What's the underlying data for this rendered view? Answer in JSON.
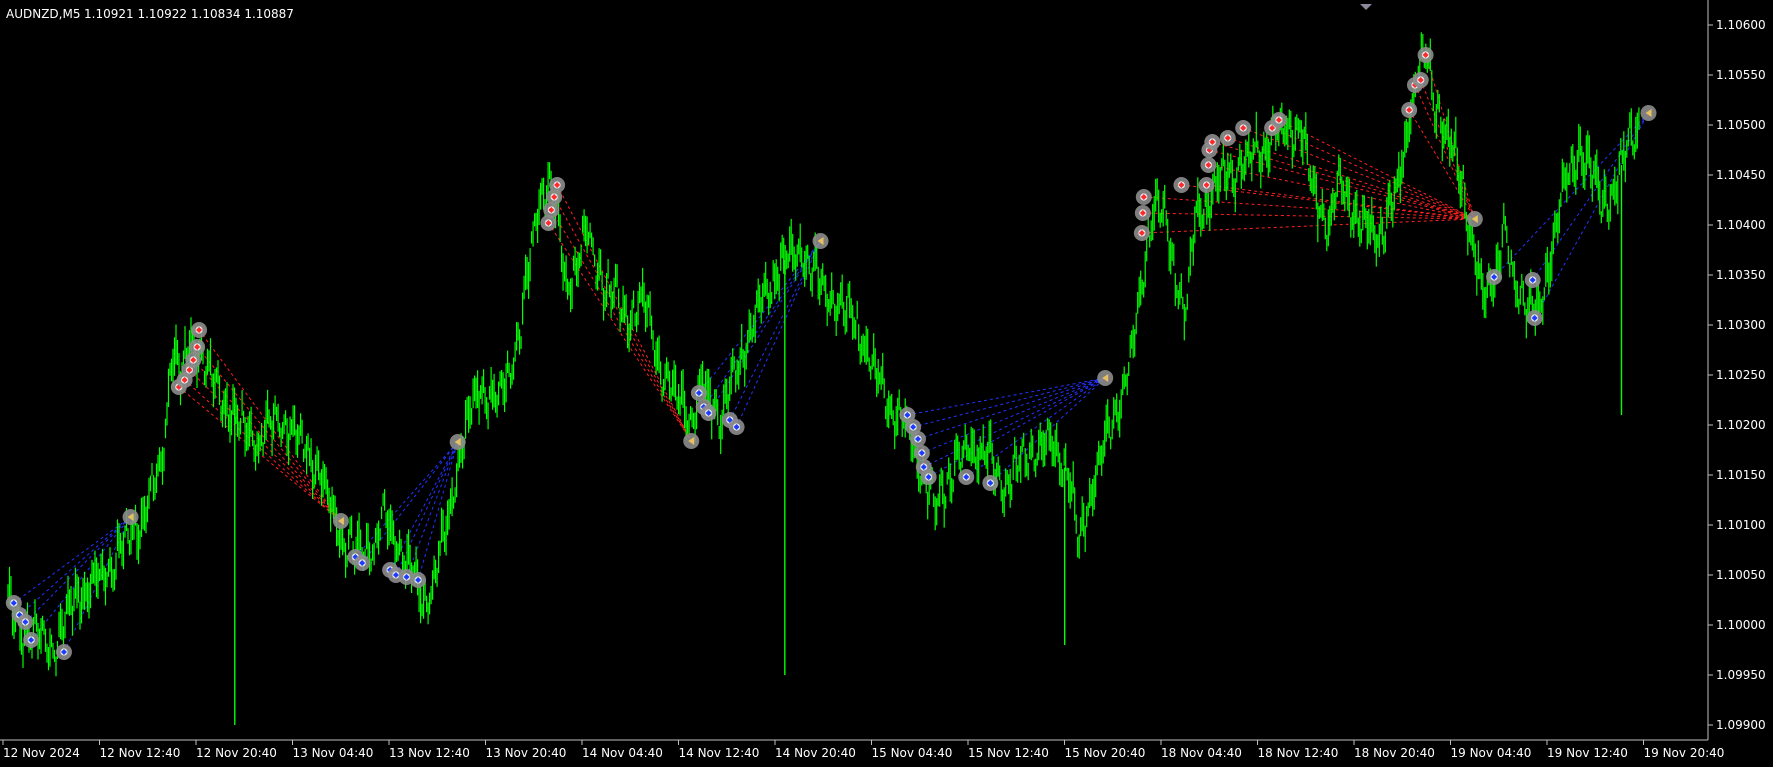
{
  "header": {
    "symbol_label": "AUDNZD,M5",
    "ohlc_text": "1.10921 1.10922 1.10834 1.10887"
  },
  "colors": {
    "background": "#000000",
    "price_line": "#00FF00",
    "axis_text": "#FFFFFF",
    "axis_frame": "#C0C0C0",
    "buy_link": "#2233FF",
    "sell_link": "#FF2020",
    "buy_marker": "#1E3CFF",
    "sell_marker": "#FF2A2A",
    "marker_halo": "#8C8C8C",
    "close_marker": "#E8C060"
  },
  "chart_data": {
    "type": "line",
    "title": "",
    "xlabel": "",
    "ylabel": "",
    "ylim": [
      1.0988,
      1.10628
    ],
    "x_tick_labels": [
      "12 Nov 2024",
      "12 Nov 12:40",
      "12 Nov 20:40",
      "13 Nov 04:40",
      "13 Nov 12:40",
      "13 Nov 20:40",
      "14 Nov 04:40",
      "14 Nov 12:40",
      "14 Nov 20:40",
      "15 Nov 04:40",
      "15 Nov 12:40",
      "15 Nov 20:40",
      "18 Nov 04:40",
      "18 Nov 12:40",
      "18 Nov 20:40",
      "19 Nov 04:40",
      "19 Nov 12:40",
      "19 Nov 20:40"
    ],
    "y_ticks": [
      "1.10600",
      "1.10550",
      "1.10500",
      "1.10450",
      "1.10400",
      "1.10350",
      "1.10300",
      "1.10250",
      "1.10200",
      "1.10150",
      "1.10100",
      "1.10050",
      "1.10000",
      "1.09950",
      "1.09900"
    ],
    "price_anchors": [
      [
        0,
        1.1002
      ],
      [
        1,
        1.1
      ],
      [
        3,
        1.09985
      ],
      [
        5,
        1.0998
      ],
      [
        7,
        1.1003
      ],
      [
        10,
        1.1005
      ],
      [
        12,
        1.1008
      ],
      [
        14,
        1.1011
      ],
      [
        16,
        1.1016
      ],
      [
        17,
        1.1028
      ],
      [
        18,
        1.1024
      ],
      [
        19,
        1.1029
      ],
      [
        20,
        1.1027
      ],
      [
        22,
        1.1023
      ],
      [
        24,
        1.102
      ],
      [
        26,
        1.1018
      ],
      [
        28,
        1.1021
      ],
      [
        30,
        1.1019
      ],
      [
        32,
        1.1016
      ],
      [
        34,
        1.101
      ],
      [
        36,
        1.1007
      ],
      [
        38,
        1.1008
      ],
      [
        39,
        1.1011
      ],
      [
        40,
        1.1009
      ],
      [
        42,
        1.1005
      ],
      [
        43,
        1.1002
      ],
      [
        44,
        1.1004
      ],
      [
        46,
        1.1012
      ],
      [
        47,
        1.1018
      ],
      [
        49,
        1.1024
      ],
      [
        51,
        1.1022
      ],
      [
        53,
        1.1029
      ],
      [
        54,
        1.1035
      ],
      [
        55,
        1.1043
      ],
      [
        56,
        1.1045
      ],
      [
        57,
        1.104
      ],
      [
        58,
        1.1034
      ],
      [
        60,
        1.1039
      ],
      [
        62,
        1.1034
      ],
      [
        64,
        1.1031
      ],
      [
        66,
        1.1032
      ],
      [
        68,
        1.1025
      ],
      [
        70,
        1.1022
      ],
      [
        71,
        1.102
      ],
      [
        72,
        1.1024
      ],
      [
        74,
        1.1021
      ],
      [
        76,
        1.1027
      ],
      [
        78,
        1.1032
      ],
      [
        80,
        1.1036
      ],
      [
        82,
        1.1038
      ],
      [
        84,
        1.1034
      ],
      [
        86,
        1.1032
      ],
      [
        88,
        1.103
      ],
      [
        90,
        1.1025
      ],
      [
        92,
        1.1021
      ],
      [
        94,
        1.1018
      ],
      [
        95,
        1.1014
      ],
      [
        96,
        1.1012
      ],
      [
        98,
        1.1016
      ],
      [
        100,
        1.1018
      ],
      [
        102,
        1.1016
      ],
      [
        103,
        1.1014
      ],
      [
        104,
        1.1015
      ],
      [
        106,
        1.1017
      ],
      [
        108,
        1.1018
      ],
      [
        110,
        1.1015
      ],
      [
        111,
        1.1008
      ],
      [
        112,
        1.1012
      ],
      [
        113,
        1.1016
      ],
      [
        114,
        1.1019
      ],
      [
        115,
        1.1022
      ],
      [
        116,
        1.1025
      ],
      [
        117,
        1.103
      ],
      [
        118,
        1.1038
      ],
      [
        119,
        1.1043
      ],
      [
        120,
        1.104
      ],
      [
        121,
        1.1035
      ],
      [
        122,
        1.1031
      ],
      [
        123,
        1.104
      ],
      [
        124,
        1.1042
      ],
      [
        126,
        1.1045
      ],
      [
        128,
        1.1046
      ],
      [
        130,
        1.1048
      ],
      [
        132,
        1.1049
      ],
      [
        134,
        1.105
      ],
      [
        135,
        1.1044
      ],
      [
        136,
        1.1042
      ],
      [
        137,
        1.104
      ],
      [
        138,
        1.1045
      ],
      [
        140,
        1.104
      ],
      [
        142,
        1.1039
      ],
      [
        144,
        1.1043
      ],
      [
        145,
        1.105
      ],
      [
        146,
        1.1055
      ],
      [
        147,
        1.1057
      ],
      [
        148,
        1.1052
      ],
      [
        149,
        1.1049
      ],
      [
        150,
        1.1047
      ],
      [
        151,
        1.1043
      ],
      [
        152,
        1.1037
      ],
      [
        153,
        1.1032
      ],
      [
        154,
        1.1035
      ],
      [
        155,
        1.104
      ],
      [
        156,
        1.1034
      ],
      [
        158,
        1.1032
      ],
      [
        159,
        1.1031
      ],
      [
        160,
        1.1038
      ],
      [
        161,
        1.1044
      ],
      [
        162,
        1.1045
      ],
      [
        163,
        1.1048
      ],
      [
        164,
        1.1046
      ],
      [
        165,
        1.1042
      ],
      [
        166,
        1.1043
      ],
      [
        168,
        1.1048
      ],
      [
        169,
        1.105
      ]
    ],
    "price_x_max": 169,
    "price_spikes": [
      {
        "x": 23.5,
        "low": 1.099
      },
      {
        "x": 80.5,
        "low": 1.0995
      },
      {
        "x": 109.5,
        "low": 1.0998
      },
      {
        "x": 167.2,
        "low": 1.1021
      }
    ],
    "closes": [
      {
        "x": 12.7,
        "y": 1.10108,
        "side": "buy"
      },
      {
        "x": 34.5,
        "y": 1.10104,
        "side": "sell"
      },
      {
        "x": 46.6,
        "y": 1.10183,
        "side": "buy"
      },
      {
        "x": 70.8,
        "y": 1.10184,
        "side": "sell"
      },
      {
        "x": 84.2,
        "y": 1.10384,
        "side": "buy"
      },
      {
        "x": 113.7,
        "y": 1.10247,
        "side": "buy"
      },
      {
        "x": 152.0,
        "y": 1.10406,
        "side": "sell"
      },
      {
        "x": 170.0,
        "y": 1.10512,
        "side": "buy"
      }
    ],
    "trades": [
      {
        "side": "buy",
        "close": 0,
        "entries": [
          [
            0.6,
            1.10022
          ],
          [
            1.2,
            1.1001
          ],
          [
            1.8,
            1.10003
          ],
          [
            2.4,
            1.09985
          ],
          [
            5.8,
            1.09973
          ]
        ]
      },
      {
        "side": "sell",
        "close": 1,
        "entries": [
          [
            17.7,
            1.10238
          ],
          [
            18.3,
            1.10245
          ],
          [
            18.8,
            1.10255
          ],
          [
            19.2,
            1.10265
          ],
          [
            19.6,
            1.10278
          ],
          [
            19.8,
            1.10295
          ]
        ]
      },
      {
        "side": "buy",
        "close": 2,
        "entries": [
          [
            36.0,
            1.10068
          ],
          [
            36.7,
            1.10062
          ],
          [
            39.6,
            1.10055
          ],
          [
            40.2,
            1.1005
          ],
          [
            41.3,
            1.10048
          ],
          [
            42.5,
            1.10045
          ]
        ]
      },
      {
        "side": "sell",
        "close": 3,
        "entries": [
          [
            56.0,
            1.10402
          ],
          [
            56.3,
            1.10415
          ],
          [
            56.6,
            1.10428
          ],
          [
            56.9,
            1.1044
          ]
        ]
      },
      {
        "side": "buy",
        "close": 4,
        "entries": [
          [
            71.6,
            1.10232
          ],
          [
            72.1,
            1.10218
          ],
          [
            72.6,
            1.10212
          ],
          [
            74.8,
            1.10205
          ],
          [
            75.5,
            1.10198
          ]
        ]
      },
      {
        "side": "buy",
        "close": 5,
        "entries": [
          [
            93.2,
            1.1021
          ],
          [
            93.8,
            1.10198
          ],
          [
            94.3,
            1.10186
          ],
          [
            94.7,
            1.10172
          ],
          [
            94.9,
            1.10158
          ],
          [
            95.4,
            1.10148
          ],
          [
            99.3,
            1.10148
          ],
          [
            101.8,
            1.10142
          ]
        ]
      },
      {
        "side": "sell",
        "close": 6,
        "entries": [
          [
            117.5,
            1.10392
          ],
          [
            117.6,
            1.10412
          ],
          [
            117.7,
            1.10428
          ],
          [
            121.6,
            1.1044
          ],
          [
            124.2,
            1.1044
          ],
          [
            124.4,
            1.1046
          ],
          [
            124.5,
            1.10475
          ],
          [
            124.8,
            1.10483
          ],
          [
            126.4,
            1.10487
          ],
          [
            128.0,
            1.10497
          ],
          [
            131.0,
            1.10497
          ],
          [
            131.7,
            1.10505
          ],
          [
            145.2,
            1.10515
          ],
          [
            145.8,
            1.1054
          ],
          [
            146.4,
            1.10545
          ],
          [
            146.9,
            1.1057
          ]
        ]
      },
      {
        "side": "buy",
        "close": 7,
        "entries": [
          [
            154.0,
            1.10348
          ],
          [
            158.0,
            1.10345
          ],
          [
            158.2,
            1.10307
          ]
        ]
      }
    ]
  }
}
